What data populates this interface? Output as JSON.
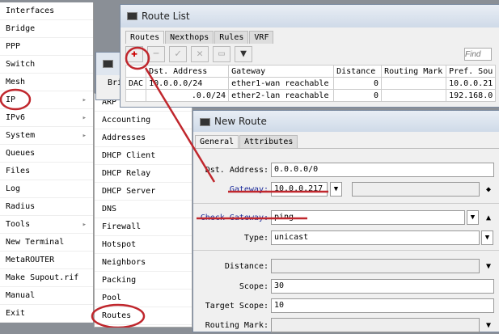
{
  "main_menu": [
    {
      "label": "Interfaces"
    },
    {
      "label": "Bridge"
    },
    {
      "label": "PPP"
    },
    {
      "label": "Switch"
    },
    {
      "label": "Mesh"
    },
    {
      "label": "IP",
      "submenu": true
    },
    {
      "label": "IPv6",
      "submenu": true
    },
    {
      "label": "System",
      "submenu": true
    },
    {
      "label": "Queues"
    },
    {
      "label": "Files"
    },
    {
      "label": "Log"
    },
    {
      "label": "Radius"
    },
    {
      "label": "Tools",
      "submenu": true
    },
    {
      "label": "New Terminal"
    },
    {
      "label": "MetaROUTER"
    },
    {
      "label": "Make Supout.rif"
    },
    {
      "label": "Manual"
    },
    {
      "label": "Exit"
    }
  ],
  "ip_submenu": [
    "ARP",
    "Accounting",
    "Addresses",
    "DHCP Client",
    "DHCP Relay",
    "DHCP Server",
    "DNS",
    "Firewall",
    "Hotspot",
    "Neighbors",
    "Packing",
    "Pool",
    "Routes"
  ],
  "back_window": {
    "text": "Bri"
  },
  "route_list": {
    "title": "Route List",
    "tabs": [
      "Routes",
      "Nexthops",
      "Rules",
      "VRF"
    ],
    "find_placeholder": "Find",
    "columns": [
      "Dst. Address",
      "Gateway",
      "Distance",
      "Routing Mark",
      "Pref. Sou"
    ],
    "rows": [
      {
        "flags": "DAC",
        "dst": "10.0.0.0/24",
        "gateway": "ether1-wan reachable",
        "distance": "0",
        "mark": "",
        "pref": "10.0.0.21"
      },
      {
        "flags": "",
        "dst": ".0.0/24",
        "gateway": "ether2-lan reachable",
        "distance": "0",
        "mark": "",
        "pref": "192.168.0"
      }
    ]
  },
  "new_route": {
    "title": "New Route",
    "tabs": [
      "General",
      "Attributes"
    ],
    "dst_label": "Dst. Address:",
    "dst_value": "0.0.0.0/0",
    "gateway_label": "Gateway:",
    "gateway_value": "10.0.0.217",
    "check_label": "Check Gateway:",
    "check_value": "ping",
    "type_label": "Type:",
    "type_value": "unicast",
    "distance_label": "Distance:",
    "scope_label": "Scope:",
    "scope_value": "30",
    "target_label": "Target Scope:",
    "target_value": "10",
    "mark_label": "Routing Mark:"
  },
  "annotation_color": "#c0272d"
}
